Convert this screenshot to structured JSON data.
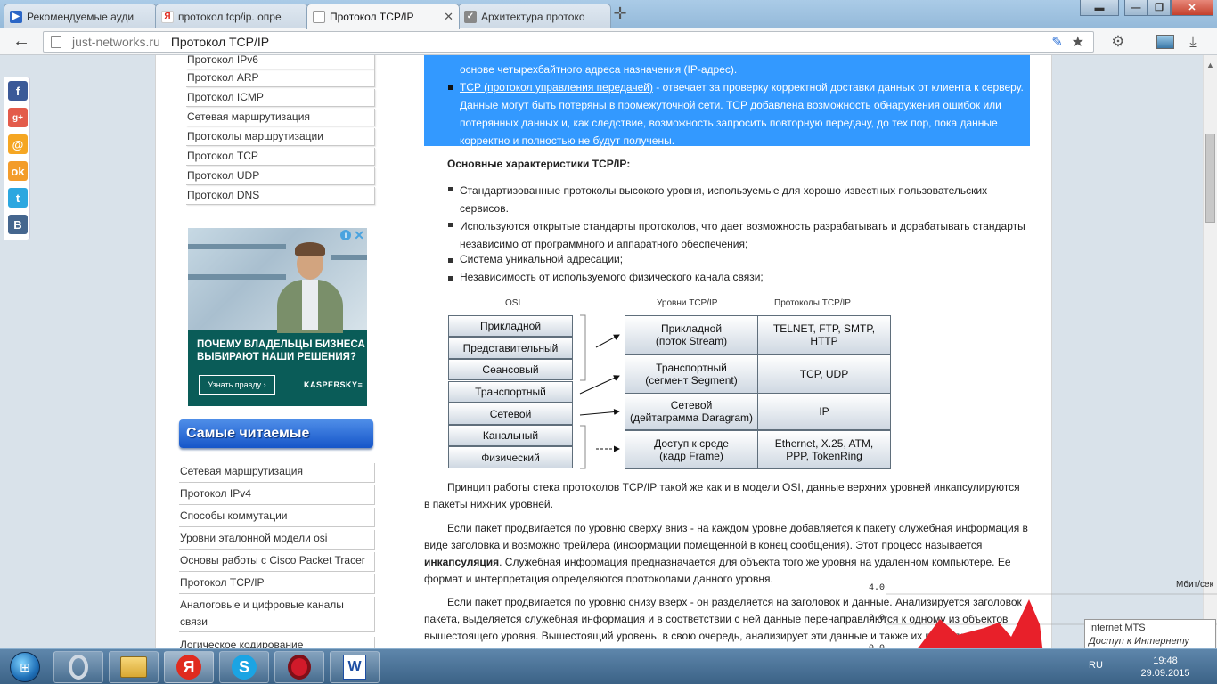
{
  "browser": {
    "tabs": [
      {
        "title": "Рекомендуемые ауди",
        "fav_letter": "▶",
        "fav_color": "#2b66c6"
      },
      {
        "title": "протокол tcp/ip. опре",
        "fav_letter": "Я",
        "fav_color": "#e02b1f"
      },
      {
        "title": "Протокол TCP/IP",
        "fav_letter": "",
        "fav_color": "#ffffff"
      },
      {
        "title": "Архитектура протоко",
        "fav_letter": "✓",
        "fav_color": "#6b6b6b"
      }
    ],
    "address": {
      "domain": "just-networks.ru",
      "page_title": "Протокол TCP/IP"
    }
  },
  "sidebar": {
    "top_nav": [
      "Протокол IPv6",
      "Протокол ARP",
      "Протокол ICMP",
      "Сетевая маршрутизация",
      "Протоколы маршрутизации",
      "Протокол TCP",
      "Протокол UDP",
      "Протокол DNS"
    ],
    "ad": {
      "headline": "ПОЧЕМУ ВЛАДЕЛЬЦЫ БИЗНЕСА ВЫБИРАЮТ НАШИ РЕШЕНИЯ?",
      "cta": "Узнать правду ›",
      "brand": "KASPERSKY≡"
    },
    "most_read_title": "Самые читаемые",
    "most_read": [
      "Сетевая маршрутизация",
      "Протокол IPv4",
      "Способы коммутации",
      "Уровни эталонной модели osi",
      "Основы работы с Cisco Packet Tracer",
      "Протокол TCP/IP",
      "Аналоговые и цифровые каналы связи",
      "Логическое кодирование"
    ]
  },
  "content": {
    "highlight_line1": "основе четырехбайтного адреса назначения (IP-адрес).",
    "tcp_link": "TCP (протокол управления передачей)",
    "tcp_line1_rest": " - отвечает за проверку корректной доставки данных от клиента к серверу.",
    "tcp_line2": "Данные могут быть потеряны в промежуточной сети. TCP добавлена возможность обнаружения ошибок или",
    "tcp_line3": "потерянных данных и, как следствие, возможность запросить повторную передачу, до тех пор, пока данные",
    "tcp_line4": "корректно и полностью не будут получены.",
    "char_heading": "Основные характеристики TCP/IP:",
    "bullets": [
      [
        "Стандартизованные протоколы высокого уровня, используемые для хорошо известных пользовательских",
        "сервисов."
      ],
      [
        "Используются открытые стандарты протоколов, что дает возможность разрабатывать и дорабатывать стандарты",
        "независимо от программного и аппаратного обеспечения;"
      ],
      [
        "Система уникальной адресации;"
      ],
      [
        "Независимость от используемого физического канала связи;"
      ]
    ],
    "diagram": {
      "col_osi": "OSI",
      "col_levels": "Уровни TCP/IP",
      "col_protocols": "Протоколы TCP/IP",
      "osi": [
        "Прикладной",
        "Представительный",
        "Сеансовый",
        "Транспортный",
        "Сетевой",
        "Канальный",
        "Физический"
      ],
      "tcpip": [
        {
          "level": "Прикладной\n(поток Stream)",
          "protocols": "TELNET, FTP, SMTP,\nHTTP"
        },
        {
          "level": "Транспортный\n(сегмент Segment)",
          "protocols": "TCP, UDP"
        },
        {
          "level": "Сетевой\n(дейтаграмма Daragram)",
          "protocols": "IP"
        },
        {
          "level": "Доступ к среде\n(кадр Frame)",
          "protocols": "Ethernet, X.25, ATM,\nPPP, TokenRing"
        }
      ]
    },
    "p1": [
      "Принцип работы стека протоколов TCP/IP такой же как и в модели OSI, данные верхних уровней инкапсулируются",
      "в пакеты нижних уровней."
    ],
    "p2_l1": "Если пакет продвигается по уровню сверху вниз - на каждом уровне добавляется к пакету служебная информация в",
    "p2_l2": "виде заголовка и возможно трейлера (информации помещенной в конец сообщения). Этот процесс называется",
    "p2_bold": "инкапсуляция",
    "p2_l3_rest": ". Служебная информация предназначается для объекта того же уровня на удаленном компьютере. Ее",
    "p2_l4": "формат и интерпретация определяются протоколами данного уровня.",
    "p3": [
      "Если пакет продвигается по уровню снизу вверх - он разделяется на заголовок и данные. Анализируется заголовок",
      "пакета, выделяется служебная информация и в соответствии с ней данные перенаправляются к одному из объектов",
      "вышестоящего уровня. Вышестоящий уровень, в свою очередь, анализирует эти данные и также их разделяет их на"
    ]
  },
  "net_widget": {
    "ticks": [
      "4.0",
      "2.0",
      "0.0"
    ],
    "unit": "Мбит/сек",
    "tooltip_line1": "Internet MTS",
    "tooltip_line2": "Доступ к Интернету",
    "graph_color": "#e8202a"
  },
  "taskbar": {
    "lang": "RU",
    "time": "19:48",
    "date": "29.09.2015"
  }
}
